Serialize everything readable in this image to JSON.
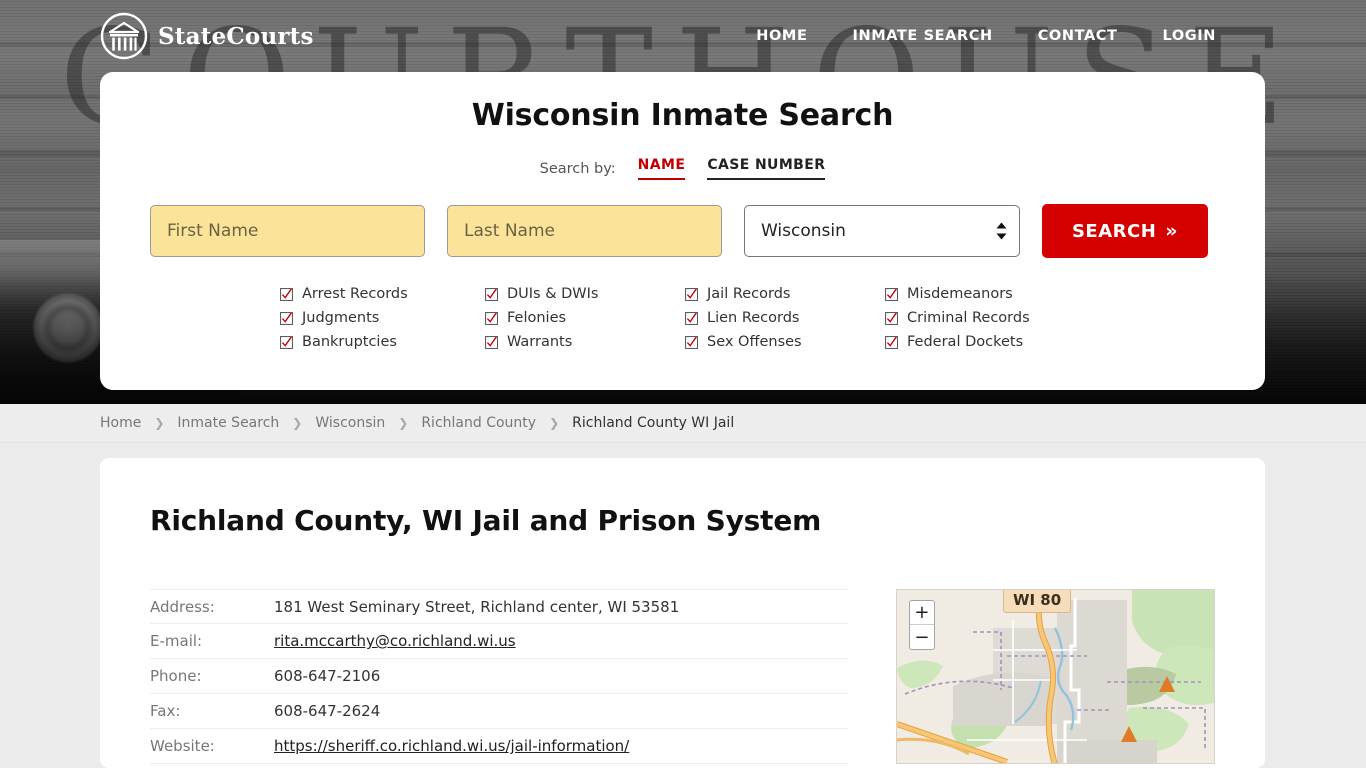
{
  "header": {
    "brand": "StateCourts",
    "logo_icon": "courthouse-circle-logo",
    "nav": [
      {
        "label": "HOME"
      },
      {
        "label": "INMATE SEARCH"
      },
      {
        "label": "CONTACT"
      },
      {
        "label": "LOGIN"
      }
    ]
  },
  "hero": {
    "background_word": "COURTHOUSE"
  },
  "search": {
    "title": "Wisconsin Inmate Search",
    "search_by_label": "Search by:",
    "tabs": [
      {
        "label": "NAME",
        "active": true
      },
      {
        "label": "CASE NUMBER",
        "active": false
      }
    ],
    "first_name": {
      "value": "",
      "placeholder": "First Name"
    },
    "last_name": {
      "value": "",
      "placeholder": "Last Name"
    },
    "state_select": {
      "value": "Wisconsin",
      "options": [
        "Wisconsin"
      ]
    },
    "button_label": "SEARCH",
    "button_chevron": "»",
    "accent_red": "#d50000",
    "tab_active_red": "#c00000",
    "field_yellow": "#fbe49a",
    "checklist": [
      {
        "label": "Arrest Records"
      },
      {
        "label": "DUIs & DWIs"
      },
      {
        "label": "Jail Records"
      },
      {
        "label": "Misdemeanors"
      },
      {
        "label": "Judgments"
      },
      {
        "label": "Felonies"
      },
      {
        "label": "Lien Records"
      },
      {
        "label": "Criminal Records"
      },
      {
        "label": "Bankruptcies"
      },
      {
        "label": "Warrants"
      },
      {
        "label": "Sex Offenses"
      },
      {
        "label": "Federal Dockets"
      }
    ]
  },
  "breadcrumb": {
    "separator": "❯",
    "items": [
      {
        "label": "Home",
        "current": false
      },
      {
        "label": "Inmate Search",
        "current": false
      },
      {
        "label": "Wisconsin",
        "current": false
      },
      {
        "label": "Richland County",
        "current": false
      },
      {
        "label": "Richland County WI Jail",
        "current": true
      }
    ]
  },
  "page": {
    "title": "Richland County, WI Jail and Prison System",
    "details": [
      {
        "label": "Address:",
        "value": "181 West Seminary Street, Richland center, WI 53581",
        "is_link": false
      },
      {
        "label": "E-mail:",
        "value": "rita.mccarthy@co.richland.wi.us",
        "is_link": true
      },
      {
        "label": "Phone:",
        "value": "608-647-2106",
        "is_link": false
      },
      {
        "label": "Fax:",
        "value": "608-647-2624",
        "is_link": false
      },
      {
        "label": "Website:",
        "value": "https://sheriff.co.richland.wi.us/jail-information/",
        "is_link": true
      }
    ]
  },
  "map": {
    "zoom_in_label": "+",
    "zoom_out_label": "−",
    "highway_label": "WI 80"
  }
}
